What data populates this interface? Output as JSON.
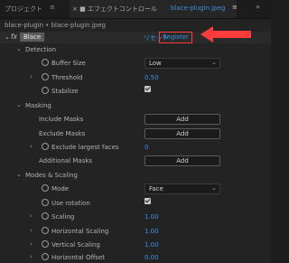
{
  "tabs": {
    "project": "プロジェクト",
    "menu_icon_1": "≡",
    "effect_controls": "× ■ エフェクトコントロール",
    "file": "blace-plugin.jpeg",
    "menu_icon_2": "≡",
    "more": "»"
  },
  "breadcrumb": "blace-plugin • blace-plugin.jpeg",
  "effect": {
    "fx": "fx",
    "name": "Blace",
    "reset": "リセット",
    "register": "Register"
  },
  "rows": {
    "detection": "Detection",
    "buffer_size": "Buffer Size",
    "buffer_size_value": "Low",
    "threshold": "Threshold",
    "threshold_value": "0.50",
    "stabilize": "Stabilize",
    "masking": "Masking",
    "include_masks": "Include Masks",
    "include_add": "Add",
    "exclude_masks": "Exclude Masks",
    "exclude_add": "Add",
    "exclude_largest": "Exclude largest faces",
    "exclude_largest_value": "0",
    "additional_masks": "Additional Masks",
    "additional_add": "Add",
    "modes_scaling": "Modes & Scaling",
    "mode": "Mode",
    "mode_value": "Face",
    "use_rotation": "Use rotation",
    "scaling": "Scaling",
    "scaling_value": "1.00",
    "h_scaling": "Horizontal Scaling",
    "h_scaling_value": "1.00",
    "v_scaling": "Vertical Scaling",
    "v_scaling_value": "1.00",
    "h_offset": "Horizontal Offset",
    "h_offset_value": "0.00"
  },
  "colors": {
    "accent": "#3d8fe0",
    "highlight": "#ff3b3b"
  }
}
